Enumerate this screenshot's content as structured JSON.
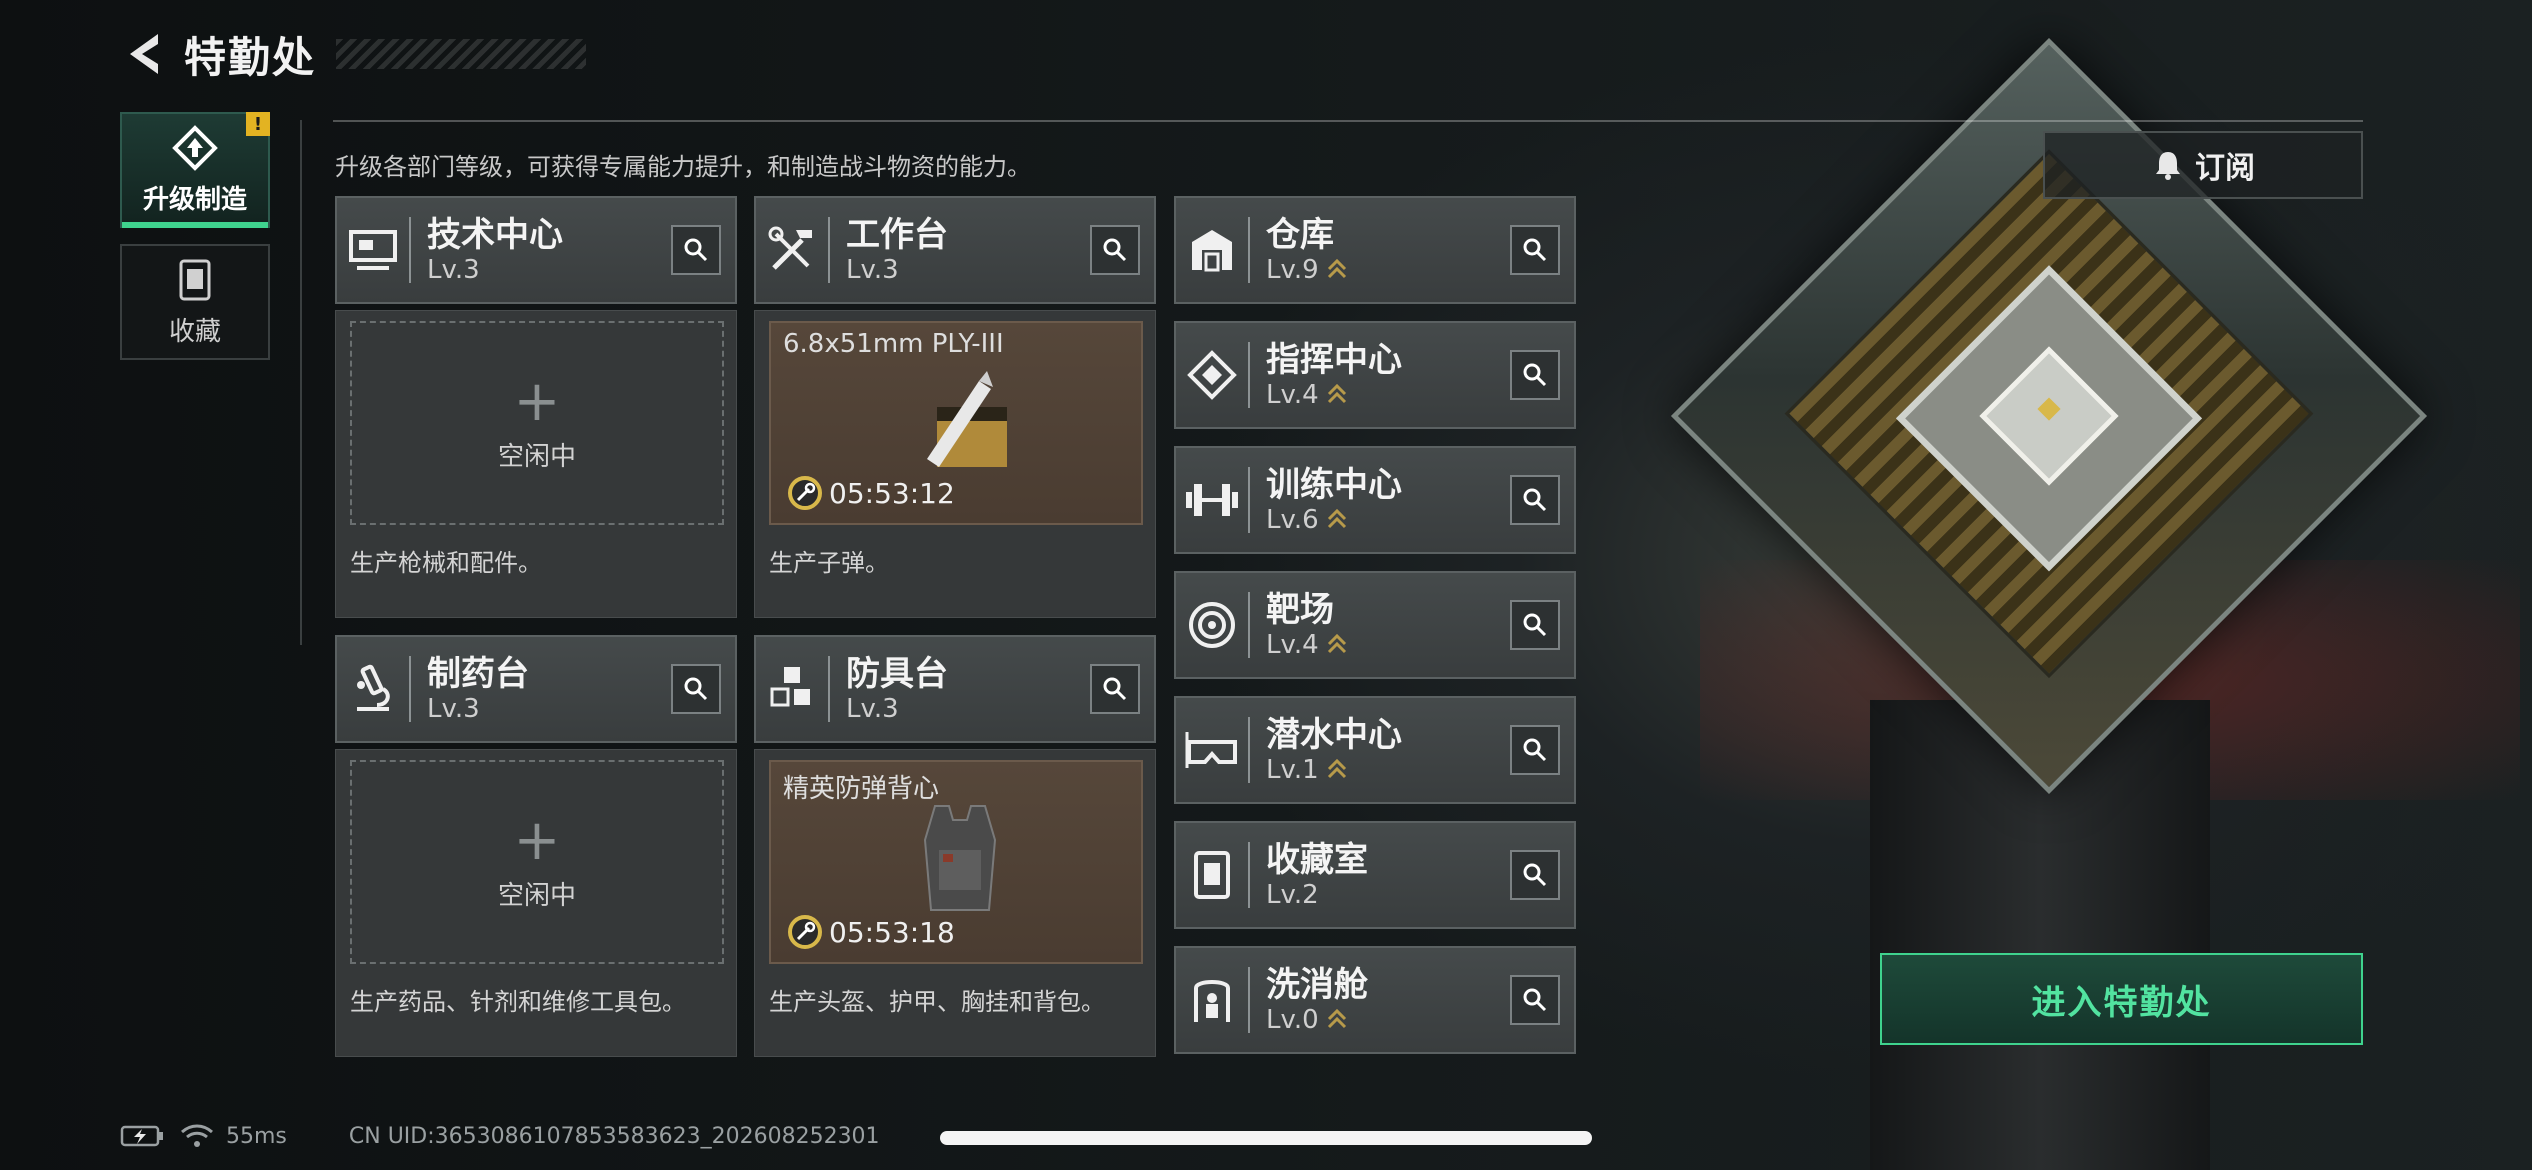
{
  "header": {
    "title": "特勤处"
  },
  "sidebar": {
    "tabs": [
      {
        "label": "升级制造",
        "active": true,
        "alert": "!"
      },
      {
        "label": "收藏",
        "active": false
      }
    ]
  },
  "intro": "升级各部门等级，可获得专属能力提升，和制造战斗物资的能力。",
  "subscribe_label": "订阅",
  "production": [
    {
      "name": "技术中心",
      "level": "Lv.3",
      "icon": "monitor-tech-icon",
      "state": "空闲中",
      "desc": "生产枪械和配件。"
    },
    {
      "name": "工作台",
      "level": "Lv.3",
      "icon": "tools-icon",
      "item": "6.8x51mm PLY-III",
      "timer": "05:53:12",
      "desc": "生产子弹。"
    },
    {
      "name": "制药台",
      "level": "Lv.3",
      "icon": "microscope-icon",
      "state": "空闲中",
      "desc": "生产药品、针剂和维修工具包。"
    },
    {
      "name": "防具台",
      "level": "Lv.3",
      "icon": "cubes-icon",
      "item": "精英防弹背心",
      "timer": "05:53:18",
      "desc": "生产头盔、护甲、胸挂和背包。"
    }
  ],
  "facilities": [
    {
      "name": "仓库",
      "level": "Lv.9",
      "icon": "warehouse-icon"
    },
    {
      "name": "指挥中心",
      "level": "Lv.4",
      "icon": "command-icon"
    },
    {
      "name": "训练中心",
      "level": "Lv.6",
      "icon": "dumbbell-icon"
    },
    {
      "name": "靶场",
      "level": "Lv.4",
      "icon": "target-icon"
    },
    {
      "name": "潜水中心",
      "level": "Lv.1",
      "icon": "dive-mask-icon"
    },
    {
      "name": "收藏室",
      "level": "Lv.2",
      "icon": "collection-icon"
    },
    {
      "name": "洗消舱",
      "level": "Lv.0",
      "icon": "decon-icon"
    }
  ],
  "enter_label": "进入特勤处",
  "status": {
    "ping": "55ms",
    "uid": "CN UID:3653086107853583623_202608252301"
  },
  "colors": {
    "accent": "#3fd38e",
    "alert": "#e3b322",
    "upgrade_chevron": "#b79a4a"
  }
}
